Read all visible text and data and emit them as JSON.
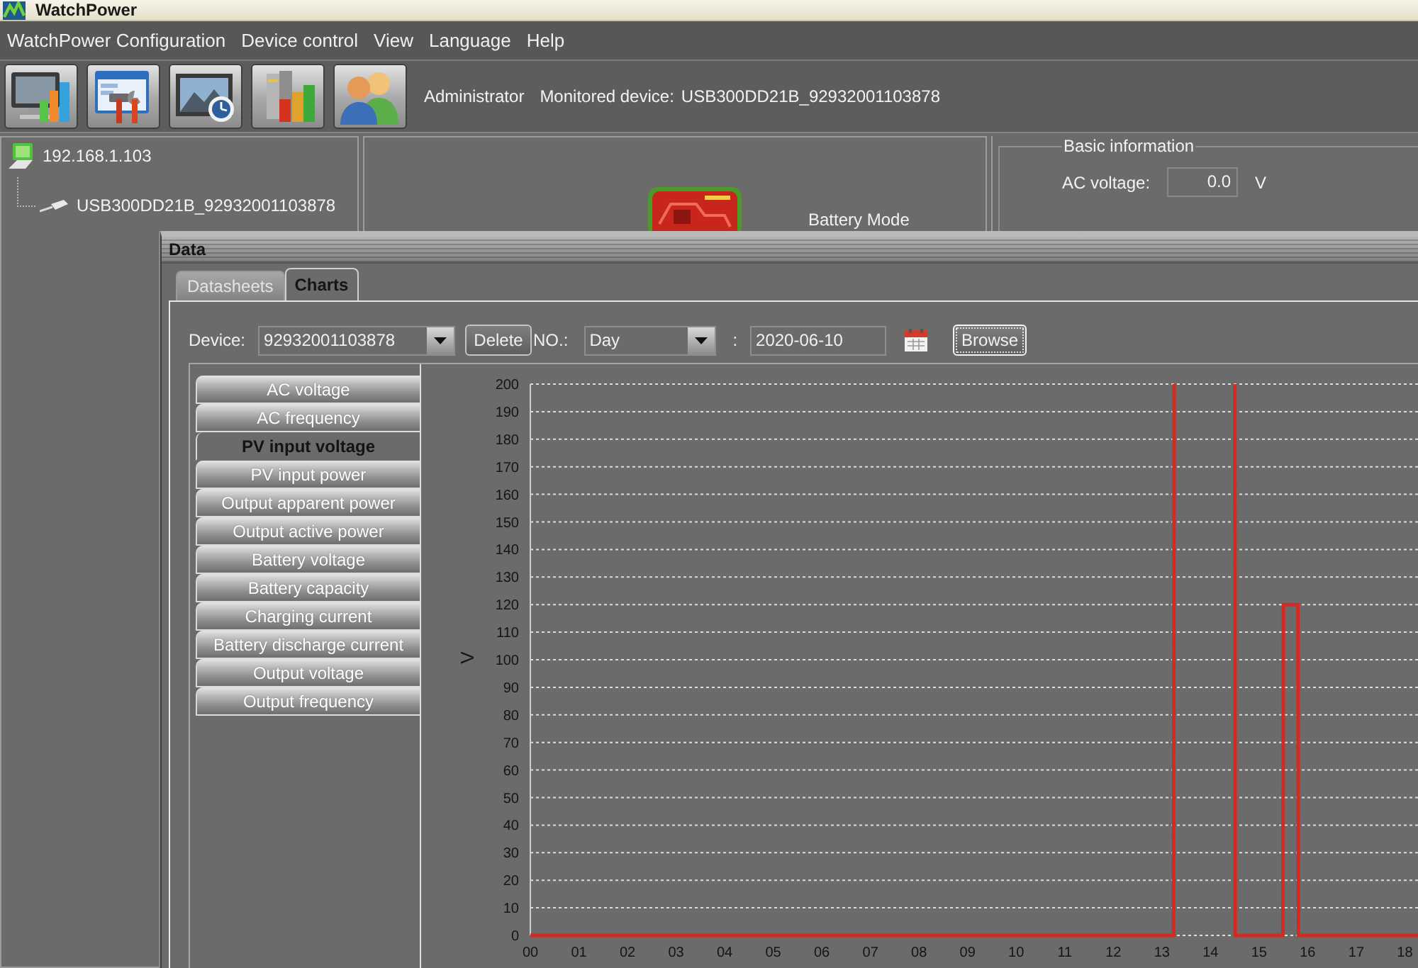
{
  "window": {
    "title": "WatchPower"
  },
  "menu": [
    {
      "label": "WatchPower Configuration"
    },
    {
      "label": "Device control"
    },
    {
      "label": "View"
    },
    {
      "label": "Language"
    },
    {
      "label": "Help"
    }
  ],
  "toolbar": {
    "user": "Administrator",
    "monitored_device_label": "Monitored device:",
    "monitored_device": "USB300DD21B_92932001103878"
  },
  "device_tree": [
    {
      "label": "192.168.1.103",
      "kind": "host",
      "children": [
        {
          "label": "USB300DD21B_92932001103878",
          "kind": "usb"
        }
      ]
    }
  ],
  "status_panel": {
    "mode": "Battery Mode"
  },
  "basic_information": {
    "title": "Basic information",
    "fields": [
      {
        "label": "AC voltage:",
        "value": "0.0",
        "unit": "V"
      }
    ]
  },
  "data_window": {
    "title": "Data",
    "tabs": [
      {
        "label": "Datasheets",
        "selected": false
      },
      {
        "label": "Charts",
        "selected": true
      }
    ],
    "device": {
      "label": "Device:",
      "value": "92932001103878"
    },
    "delete_button": "Delete",
    "period": {
      "label": "NO.:",
      "value": "Day"
    },
    "date_separator": ":",
    "date": "2020-06-10",
    "browse_button": "Browse",
    "series_tabs": [
      {
        "label": "AC voltage",
        "selected": false
      },
      {
        "label": "AC frequency",
        "selected": false
      },
      {
        "label": "PV input voltage",
        "selected": true
      },
      {
        "label": "PV input power",
        "selected": false
      },
      {
        "label": "Output apparent power",
        "selected": false
      },
      {
        "label": "Output active power",
        "selected": false
      },
      {
        "label": "Battery voltage",
        "selected": false
      },
      {
        "label": "Battery capacity",
        "selected": false
      },
      {
        "label": "Charging current",
        "selected": false
      },
      {
        "label": "Battery discharge current",
        "selected": false
      },
      {
        "label": "Output voltage",
        "selected": false
      },
      {
        "label": "Output frequency",
        "selected": false
      }
    ],
    "chart": {
      "chart_data": {
        "type": "line",
        "ylabel": "V",
        "grid": true,
        "x": [
          0,
          13.24,
          13.25,
          13.9,
          14.5,
          14.51,
          15.49,
          15.5,
          15.8,
          15.81,
          18.3
        ],
        "series": [
          {
            "color": "#d42a24",
            "values": [
              0,
              0,
              200,
              null,
              200,
              0,
              0,
              120,
              120,
              0,
              0
            ]
          }
        ],
        "xlim": [
          0,
          18.3
        ],
        "ylim": [
          0,
          200
        ],
        "xticks": [
          {
            "value": 0,
            "label": "00"
          },
          {
            "value": 1,
            "label": "01"
          },
          {
            "value": 2,
            "label": "02"
          },
          {
            "value": 3,
            "label": "03"
          },
          {
            "value": 4,
            "label": "04"
          },
          {
            "value": 5,
            "label": "05"
          },
          {
            "value": 6,
            "label": "06"
          },
          {
            "value": 7,
            "label": "07"
          },
          {
            "value": 8,
            "label": "08"
          },
          {
            "value": 9,
            "label": "09"
          },
          {
            "value": 10,
            "label": "10"
          },
          {
            "value": 11,
            "label": "11"
          },
          {
            "value": 12,
            "label": "12"
          },
          {
            "value": 13,
            "label": "13"
          },
          {
            "value": 14,
            "label": "14"
          },
          {
            "value": 15,
            "label": "15"
          },
          {
            "value": 16,
            "label": "16"
          },
          {
            "value": 17,
            "label": "17"
          },
          {
            "value": 18,
            "label": "18"
          }
        ],
        "yticks": [
          0,
          10,
          20,
          30,
          40,
          50,
          60,
          70,
          80,
          90,
          100,
          110,
          120,
          130,
          140,
          150,
          160,
          170,
          180,
          190,
          200
        ]
      }
    }
  }
}
